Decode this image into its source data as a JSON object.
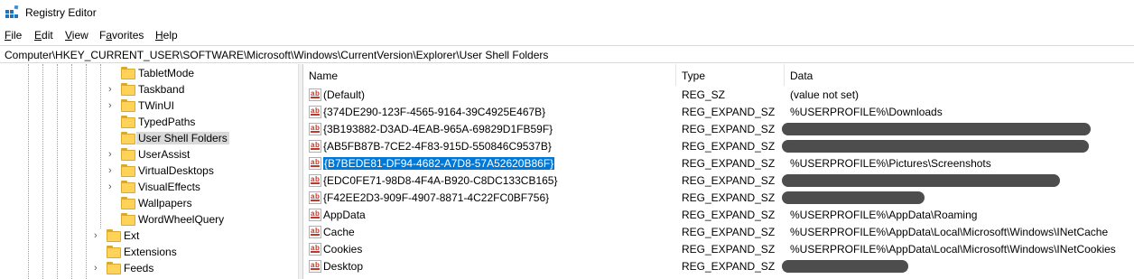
{
  "window": {
    "title": "Registry Editor"
  },
  "menu": [
    {
      "u": "F",
      "rest": "ile"
    },
    {
      "u": "E",
      "rest": "dit"
    },
    {
      "u": "V",
      "rest": "iew"
    },
    {
      "u": "",
      "pre": "F",
      "u2": "a",
      "rest": "vorites"
    },
    {
      "u": "H",
      "rest": "elp"
    }
  ],
  "menu_labels": {
    "file_u": "F",
    "file_rest": "ile",
    "edit_u": "E",
    "edit_rest": "dit",
    "view_u": "V",
    "view_rest": "iew",
    "fav_pre": "F",
    "fav_u": "a",
    "fav_rest": "vorites",
    "help_u": "H",
    "help_rest": "elp"
  },
  "address": "Computer\\HKEY_CURRENT_USER\\SOFTWARE\\Microsoft\\Windows\\CurrentVersion\\Explorer\\User Shell Folders",
  "tree": [
    {
      "label": "TabletMode",
      "chevron": false,
      "selected": false
    },
    {
      "label": "Taskband",
      "chevron": true,
      "selected": false
    },
    {
      "label": "TWinUI",
      "chevron": true,
      "selected": false
    },
    {
      "label": "TypedPaths",
      "chevron": false,
      "selected": false
    },
    {
      "label": "User Shell Folders",
      "chevron": false,
      "selected": true
    },
    {
      "label": "UserAssist",
      "chevron": true,
      "selected": false
    },
    {
      "label": "VirtualDesktops",
      "chevron": true,
      "selected": false
    },
    {
      "label": "VisualEffects",
      "chevron": true,
      "selected": false
    },
    {
      "label": "Wallpapers",
      "chevron": false,
      "selected": false
    },
    {
      "label": "WordWheelQuery",
      "chevron": false,
      "selected": false
    },
    {
      "label": "Ext",
      "chevron": true,
      "selected": false
    },
    {
      "label": "Extensions",
      "chevron": false,
      "selected": false
    },
    {
      "label": "Feeds",
      "chevron": true,
      "selected": false
    }
  ],
  "columns": {
    "name": "Name",
    "type": "Type",
    "data": "Data"
  },
  "values": [
    {
      "name": "(Default)",
      "type": "REG_SZ",
      "data": "(value not set)",
      "redacted": false,
      "selected": false
    },
    {
      "name": "{374DE290-123F-4565-9164-39C4925E467B}",
      "type": "REG_EXPAND_SZ",
      "data": "%USERPROFILE%\\Downloads",
      "redacted": false,
      "selected": false
    },
    {
      "name": "{3B193882-D3AD-4EAB-965A-69829D1FB59F}",
      "type": "REG_EXPAND_SZ",
      "data": "",
      "redacted": true,
      "selected": false
    },
    {
      "name": "{AB5FB87B-7CE2-4F83-915D-550846C9537B}",
      "type": "REG_EXPAND_SZ",
      "data": "",
      "redacted": true,
      "selected": false
    },
    {
      "name": "{B7BEDE81-DF94-4682-A7D8-57A52620B86F}",
      "type": "REG_EXPAND_SZ",
      "data": "%USERPROFILE%\\Pictures\\Screenshots",
      "redacted": false,
      "selected": true
    },
    {
      "name": "{EDC0FE71-98D8-4F4A-B920-C8DC133CB165}",
      "type": "REG_EXPAND_SZ",
      "data": "",
      "redacted": true,
      "selected": false
    },
    {
      "name": "{F42EE2D3-909F-4907-8871-4C22FC0BF756}",
      "type": "REG_EXPAND_SZ",
      "data": "",
      "redacted": true,
      "selected": false
    },
    {
      "name": "AppData",
      "type": "REG_EXPAND_SZ",
      "data": "%USERPROFILE%\\AppData\\Roaming",
      "redacted": false,
      "selected": false
    },
    {
      "name": "Cache",
      "type": "REG_EXPAND_SZ",
      "data": "%USERPROFILE%\\AppData\\Local\\Microsoft\\Windows\\INetCache",
      "redacted": false,
      "selected": false
    },
    {
      "name": "Cookies",
      "type": "REG_EXPAND_SZ",
      "data": "%USERPROFILE%\\AppData\\Local\\Microsoft\\Windows\\INetCookies",
      "redacted": false,
      "selected": false
    },
    {
      "name": "Desktop",
      "type": "REG_EXPAND_SZ",
      "data": "",
      "redacted": true,
      "selected": false
    }
  ],
  "colors": {
    "selection": "#0078d7",
    "tree_selection": "#d9d9d9",
    "folder": "#ffd35a",
    "redaction": "#4d4d4d"
  },
  "icons": {
    "app": "registry-editor-icon",
    "value": "string-value-ab-icon",
    "folder": "folder-icon",
    "expand": "chevron-right-icon"
  }
}
